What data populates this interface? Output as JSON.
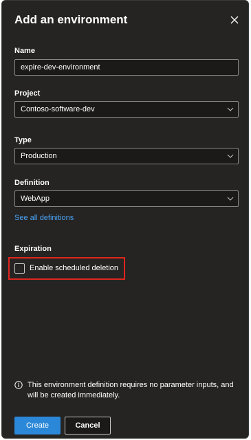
{
  "dialog": {
    "title": "Add an environment",
    "close_icon": "close-icon"
  },
  "name": {
    "label": "Name",
    "value": "expire-dev-environment"
  },
  "project": {
    "label": "Project",
    "value": "Contoso-software-dev"
  },
  "type": {
    "label": "Type",
    "value": "Production"
  },
  "definition": {
    "label": "Definition",
    "value": "WebApp",
    "link": "See all definitions"
  },
  "expiration": {
    "label": "Expiration",
    "checkbox_label": "Enable scheduled deletion",
    "checked": false
  },
  "info": {
    "icon": "info-icon",
    "text": "This environment definition requires no parameter inputs, and will be created immediately."
  },
  "actions": {
    "create_label": "Create",
    "cancel_label": "Cancel"
  },
  "colors": {
    "panel_bg": "#252423",
    "accent": "#2b88d8",
    "link": "#4aa3f5",
    "highlight": "#e0261d"
  }
}
